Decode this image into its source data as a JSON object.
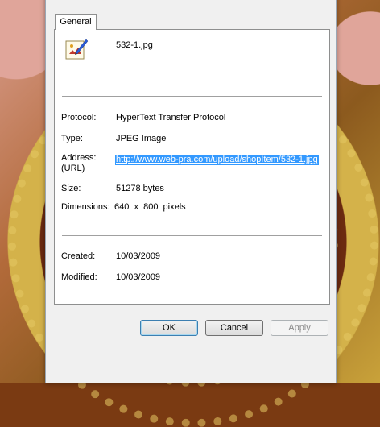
{
  "tabs": [
    {
      "label": "General"
    }
  ],
  "file": {
    "name": "532-1.jpg",
    "icon": "jpeg-image-file-icon"
  },
  "properties": {
    "protocol": {
      "label": "Protocol:",
      "value": "HyperText Transfer Protocol"
    },
    "type": {
      "label": "Type:",
      "value": "JPEG Image"
    },
    "address": {
      "label": "Address:",
      "label2": "(URL)",
      "value": "http://www.web-pra.com/upload/shopItem/532-1.jpg"
    },
    "size": {
      "label": "Size:",
      "value": "51278 bytes"
    },
    "dimensions": {
      "label": "Dimensions:",
      "value": "640  x  800  pixels"
    },
    "created": {
      "label": "Created:",
      "value": "10/03/2009"
    },
    "modified": {
      "label": "Modified:",
      "value": "10/03/2009"
    }
  },
  "buttons": {
    "ok": "OK",
    "cancel": "Cancel",
    "apply": "Apply"
  },
  "colors": {
    "selection": "#3399ff",
    "dialog_bg": "#f0f0f0",
    "panel_bg": "#ffffff"
  }
}
